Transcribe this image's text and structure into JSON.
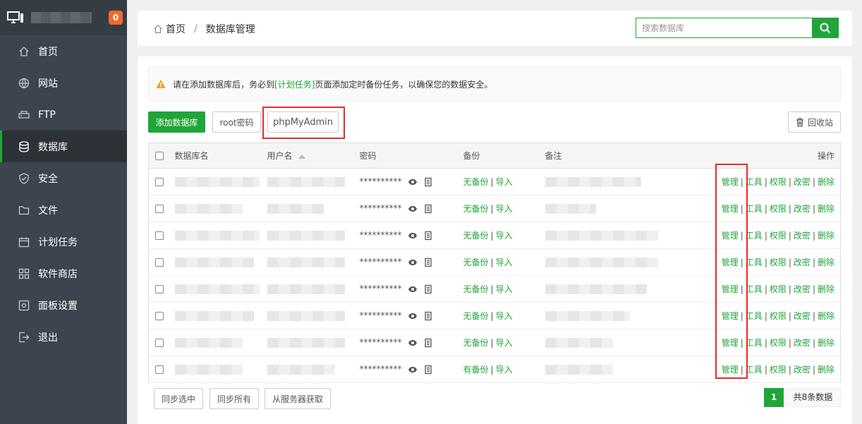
{
  "sidebar": {
    "badge": "0",
    "items": [
      {
        "label": "首页",
        "icon": "home-icon"
      },
      {
        "label": "网站",
        "icon": "globe-icon"
      },
      {
        "label": "FTP",
        "icon": "ftp-icon"
      },
      {
        "label": "数据库",
        "icon": "database-icon",
        "active": true
      },
      {
        "label": "安全",
        "icon": "shield-icon"
      },
      {
        "label": "文件",
        "icon": "folder-icon"
      },
      {
        "label": "计划任务",
        "icon": "calendar-icon"
      },
      {
        "label": "软件商店",
        "icon": "grid-icon"
      },
      {
        "label": "面板设置",
        "icon": "settings-icon"
      },
      {
        "label": "退出",
        "icon": "logout-icon"
      }
    ]
  },
  "header": {
    "breadcrumb_home": "首页",
    "breadcrumb_sep": "/",
    "breadcrumb_current": "数据库管理",
    "search_placeholder": "搜索数据库"
  },
  "notice": {
    "text_before": "请在添加数据库后，务必到",
    "link": "[计划任务]",
    "text_after": "页面添加定时备份任务，以确保您的数据安全。"
  },
  "toolbar": {
    "add": "添加数据库",
    "root_password": "root密码",
    "phpmyadmin": "phpMyAdmin",
    "recycle": "回收站"
  },
  "table": {
    "headers": {
      "name": "数据库名",
      "user": "用户名",
      "password": "密码",
      "backup": "备份",
      "remark": "备注",
      "ops": "操作"
    },
    "password_mask": "**********",
    "import_label": "导入",
    "ops": {
      "manage": "管理",
      "tools": "工具",
      "perm": "权限",
      "chpw": "改密",
      "delete": "删除"
    },
    "rows": [
      {
        "backup": "无备份"
      },
      {
        "backup": "无备份"
      },
      {
        "backup": "无备份"
      },
      {
        "backup": "无备份"
      },
      {
        "backup": "无备份"
      },
      {
        "backup": "无备份"
      },
      {
        "backup": "无备份"
      },
      {
        "backup": "有备份"
      }
    ]
  },
  "footer": {
    "sync_selected": "同步选中",
    "sync_all": "同步所有",
    "fetch_server": "从服务器获取",
    "page": "1",
    "total": "共8条数据"
  },
  "colors": {
    "accent": "#20a53a",
    "sidebar": "#3c444d",
    "badge": "#f0692a",
    "highlight": "#e52b2b"
  }
}
